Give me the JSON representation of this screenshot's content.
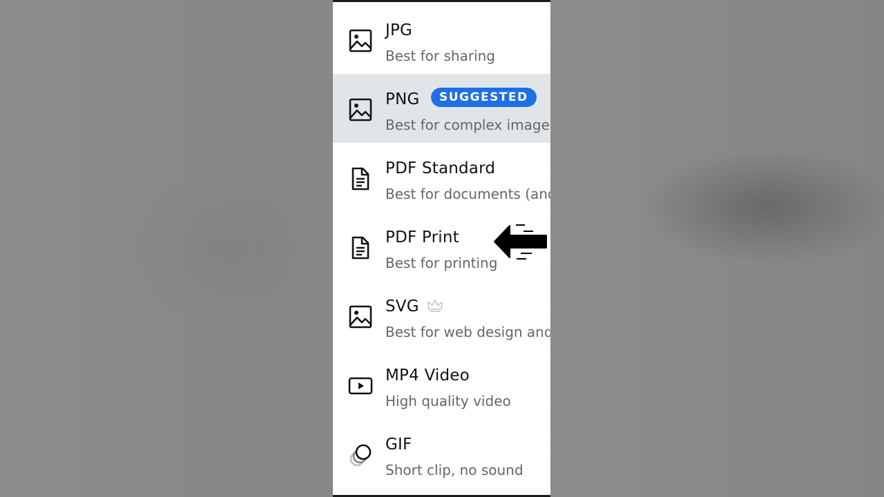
{
  "download_menu": {
    "options": [
      {
        "title": "JPG",
        "description": "Best for sharing",
        "icon": "image-icon",
        "selected": false
      },
      {
        "title": "PNG",
        "description": "Best for complex images",
        "icon": "image-icon",
        "selected": true,
        "badge": "SUGGESTED"
      },
      {
        "title": "PDF Standard",
        "description": "Best for documents (and",
        "icon": "document-icon",
        "selected": false
      },
      {
        "title": "PDF Print",
        "description": "Best for printing",
        "icon": "document-icon",
        "selected": false
      },
      {
        "title": "SVG",
        "description": "Best for web design and",
        "icon": "image-icon",
        "selected": false,
        "premium": "crown-icon"
      },
      {
        "title": "MP4 Video",
        "description": "High quality video",
        "icon": "video-play-icon",
        "selected": false
      },
      {
        "title": "GIF",
        "description": "Short clip, no sound",
        "icon": "gif-circles-icon",
        "selected": false
      }
    ]
  },
  "annotation": {
    "icon": "pointing-arrow-icon",
    "target": "PDF Print"
  },
  "colors": {
    "badge": "#1f6fe5",
    "selected_row": "#e1e5e9",
    "title_text": "#0e1318",
    "description_text": "#62666b",
    "backdrop": "#8a8a8a"
  }
}
